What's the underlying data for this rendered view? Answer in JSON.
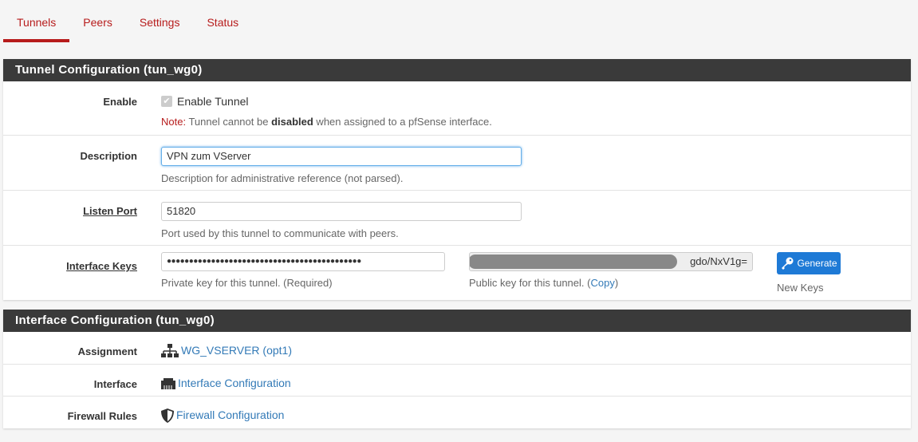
{
  "tabs": [
    {
      "label": "Tunnels",
      "active": true
    },
    {
      "label": "Peers"
    },
    {
      "label": "Settings"
    },
    {
      "label": "Status"
    }
  ],
  "tunnel": {
    "title": "Tunnel Configuration (tun_wg0)",
    "enable": {
      "label": "Enable",
      "checkbox_label": "Enable Tunnel",
      "checked": true,
      "note_prefix": "Note:",
      "note_1": " Tunnel cannot be ",
      "note_bold": "disabled",
      "note_2": " when assigned to a pfSense interface."
    },
    "description": {
      "label": "Description",
      "value": "VPN zum VServer",
      "help": "Description for administrative reference (not parsed)."
    },
    "listen_port": {
      "label": "Listen Port",
      "value": "51820",
      "help": "Port used by this tunnel to communicate with peers."
    },
    "keys": {
      "label": "Interface Keys",
      "private_value": "●●●●●●●●●●●●●●●●●●●●●●●●●●●●●●●●●●●●●●●●●●●●",
      "private_help": "Private key for this tunnel. (Required)",
      "public_value": "gdo/NxV1g=",
      "public_help": "Public key for this tunnel. (",
      "copy": "Copy",
      "public_help_end": ")",
      "generate": "Generate",
      "generate_help": "New Keys"
    }
  },
  "interface": {
    "title": "Interface Configuration (tun_wg0)",
    "rows": [
      {
        "label": "Assignment",
        "icon": "sitemap-icon",
        "link": "WG_VSERVER (opt1)"
      },
      {
        "label": "Interface",
        "icon": "ethernet-icon",
        "link": "Interface Configuration"
      },
      {
        "label": "Firewall Rules",
        "icon": "shield-icon",
        "link": "Firewall Configuration"
      }
    ]
  },
  "colors": {
    "accent": "#b71c1c",
    "header": "#3a3a3a",
    "link": "#337ab7",
    "button": "#1e7ad6"
  }
}
